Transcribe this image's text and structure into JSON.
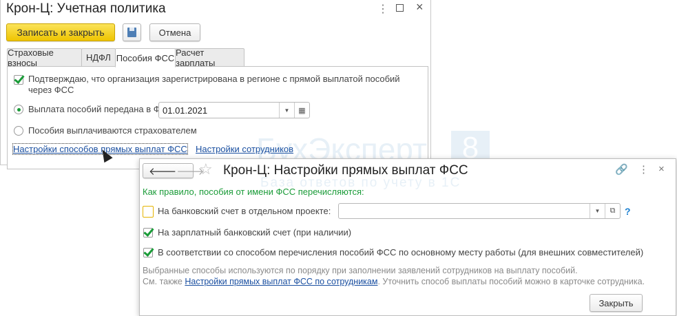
{
  "main_window": {
    "title": "Крон-Ц: Учетная политика",
    "save_close_label": "Записать и закрыть",
    "cancel_label": "Отмена",
    "tabs": [
      {
        "label": "Страховые взносы",
        "active": false
      },
      {
        "label": "НДФЛ",
        "active": false
      },
      {
        "label": "Пособия ФСС",
        "active": true
      },
      {
        "label": "Расчет зарплаты",
        "active": false
      }
    ],
    "confirm_checkbox": {
      "label_line1": "Подтверждаю, что организация зарегистрирована в регионе с прямой выплатой пособий",
      "label_line2": "через ФСС",
      "checked": true
    },
    "radio_transferred": {
      "label": "Выплата пособий передана в ФСС с:",
      "selected": true
    },
    "date_value": "01.01.2021",
    "radio_insurer": {
      "label": "Пособия выплачиваются страхователем",
      "selected": false
    },
    "link_methods": "Настройки способов прямых выплат ФСС",
    "link_employees": "Настройки сотрудников"
  },
  "watermark": {
    "brand": "БухЭксперт",
    "number": "8",
    "tagline": "База ответов по учету в 1С"
  },
  "dialog": {
    "title": "Крон-Ц: Настройки прямых выплат ФСС",
    "intro": "Как правило, пособия от имени ФСС перечисляются:",
    "options": [
      {
        "label": "На банковский счет в отдельном проекте:",
        "checked": false
      },
      {
        "label": "На зарплатный банковский счет (при наличии)",
        "checked": true
      },
      {
        "label": "В соответствии со способом перечисления пособий ФСС по основному месту работы (для внешних совместителей)",
        "checked": true
      }
    ],
    "project_value": "",
    "help_label": "?",
    "note_line1": "Выбранные способы используются по порядку при заполнении заявлений сотрудников на выплату пособий.",
    "note_prefix": "См. также ",
    "note_link": "Настройки прямых выплат ФСС по сотрудникам",
    "note_suffix": ". Уточнить способ выплаты пособий можно в карточке сотрудника.",
    "close_label": "Закрыть"
  },
  "colors": {
    "accent_yellow": "#f2c80f",
    "green": "#1a9b38",
    "link": "#1a4fa0"
  }
}
